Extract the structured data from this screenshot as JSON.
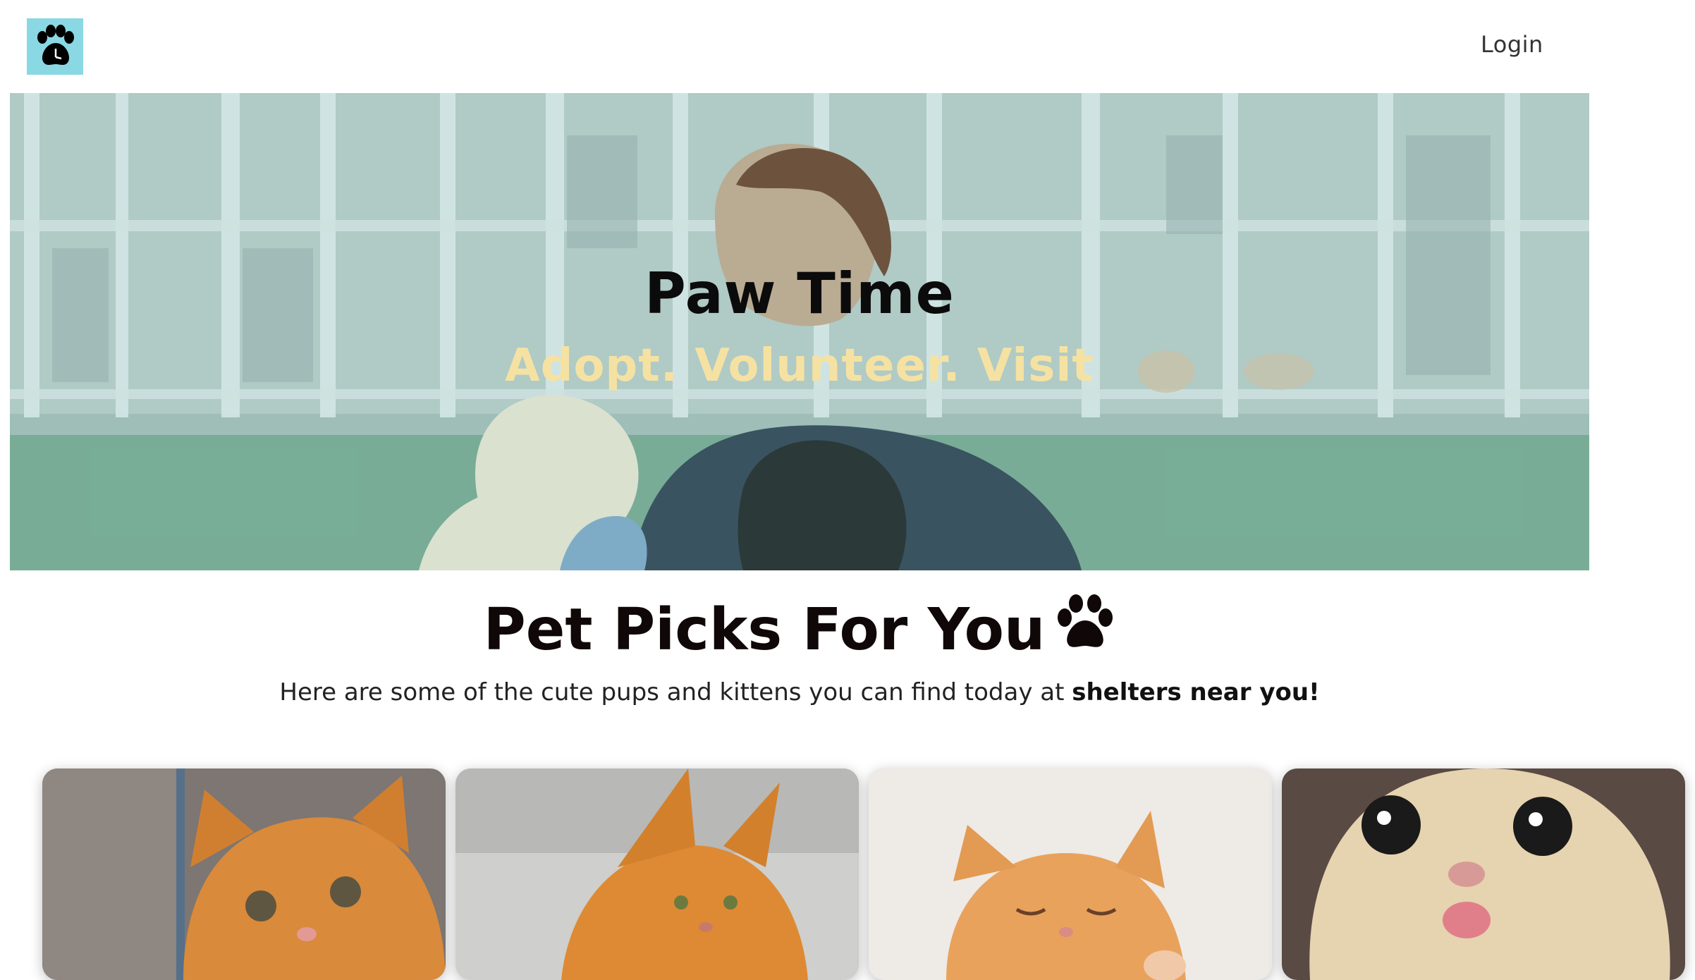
{
  "header": {
    "login_label": "Login",
    "logo_icon": "paw-clock-icon"
  },
  "hero": {
    "title": "Paw Time",
    "tagline": "Adopt. Volunteer. Visit"
  },
  "picks": {
    "title": "Pet Picks For You",
    "title_icon": "paw-icon",
    "subtitle_plain": "Here are some of the cute pups and kittens you can find today at ",
    "subtitle_bold": "shelters near you!"
  },
  "cards": [
    {
      "alt": "kitten-photo-1"
    },
    {
      "alt": "kitten-photo-2"
    },
    {
      "alt": "kitten-photo-3"
    },
    {
      "alt": "kitten-photo-4"
    }
  ],
  "colors": {
    "logo_bg": "#8ad8e4",
    "tagline": "#f5e2a2",
    "title": "#0b0b0b"
  }
}
